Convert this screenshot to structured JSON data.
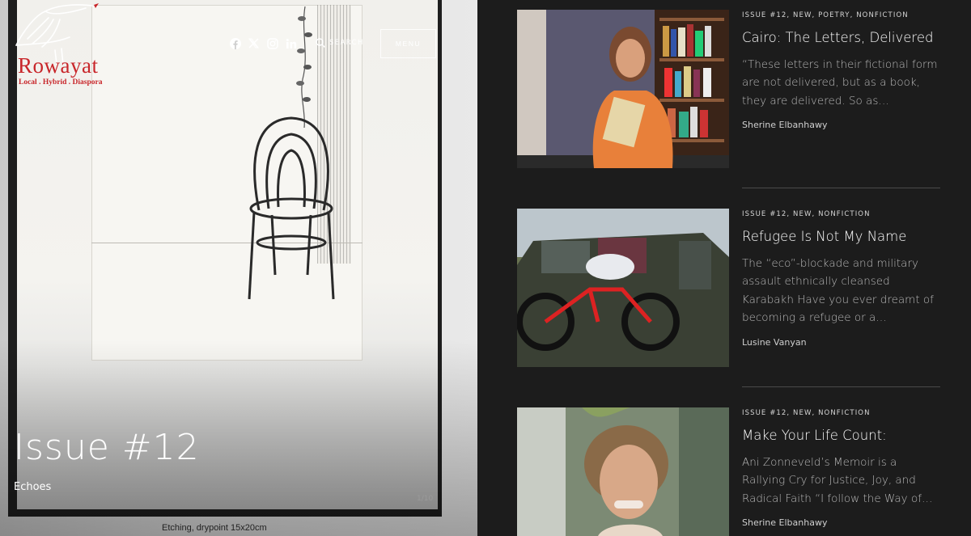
{
  "logo": {
    "name": "Rowayat",
    "tagline": "Local . Hybrid . Diaspora"
  },
  "header": {
    "social_icons": [
      "facebook-icon",
      "x-icon",
      "instagram-icon",
      "linkedin-icon"
    ],
    "search_label": "SEARCH",
    "menu_label": "MENU"
  },
  "hero": {
    "title": "Issue #12",
    "subtitle": "Echoes",
    "caption": "Etching, drypoint 15x20cm",
    "mark": "1/10"
  },
  "articles": [
    {
      "categories": "ISSUE #12, NEW, POETRY, NONFICTION",
      "title": "Cairo: The Letters, Delivered",
      "excerpt": "“These letters in their fictional form are not delivered, but as a book, they are delivered. So as…",
      "author": "Sherine Elbanhawy"
    },
    {
      "categories": "ISSUE #12, NEW, NONFICTION",
      "title": "Refugee Is Not My Name",
      "excerpt": "The “eco”-blockade and military assault ethnically cleansed Karabakh Have you ever dreamt of becoming a refugee or a…",
      "author": "Lusine Vanyan"
    },
    {
      "categories": "ISSUE #12, NEW, NONFICTION",
      "title": "Make Your Life Count:",
      "excerpt": "Ani Zonneveld’s Memoir is a Rallying Cry for Justice, Joy, and Radical Faith “I follow the Way of…",
      "author": "Sherine Elbanhawy"
    }
  ],
  "colors": {
    "brand_red": "#c8262a",
    "background": "#1c1c1c",
    "text": "#ffffff"
  }
}
